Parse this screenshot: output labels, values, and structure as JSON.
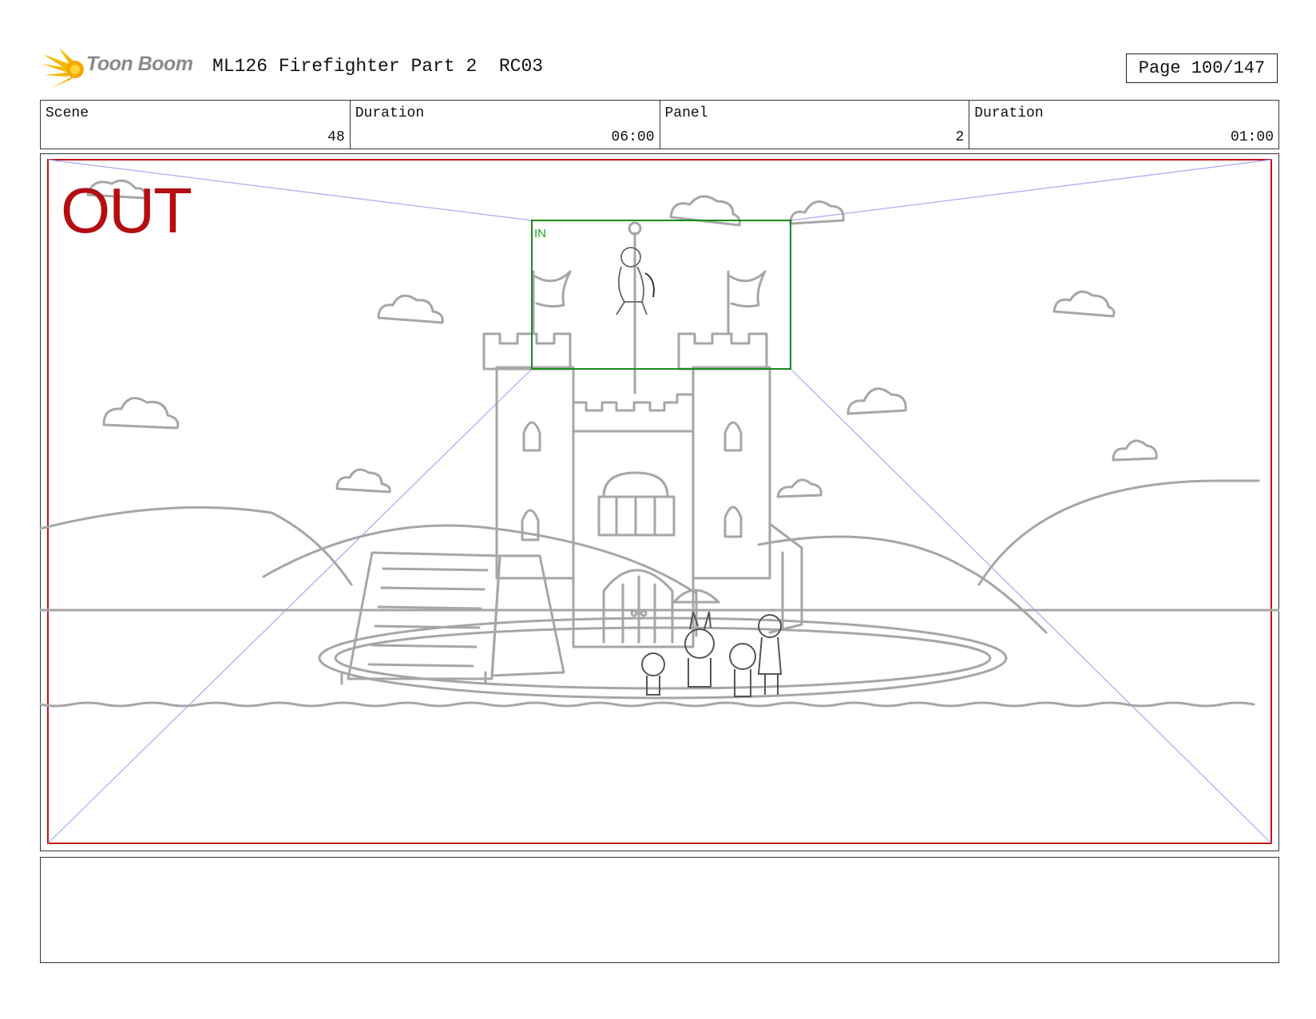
{
  "header": {
    "logo_text": "Toon Boom",
    "title": "ML126 Firefighter Part 2  RC03",
    "page_label": "Page 100/147"
  },
  "info": {
    "scene_label": "Scene",
    "scene_value": "48",
    "scene_duration_label": "Duration",
    "scene_duration_value": "06:00",
    "panel_label": "Panel",
    "panel_value": "2",
    "panel_duration_label": "Duration",
    "panel_duration_value": "01:00"
  },
  "panel": {
    "out_label": "OUT",
    "in_label": "IN",
    "out_frame_color": "#c0121a",
    "in_frame_color": "#1a8a1a",
    "guide_color": "#a8a8f0",
    "sketch_color": "#a0a0a0"
  },
  "notes": {
    "text": ""
  },
  "icons": {
    "logo": "toon-boom-star-icon"
  }
}
